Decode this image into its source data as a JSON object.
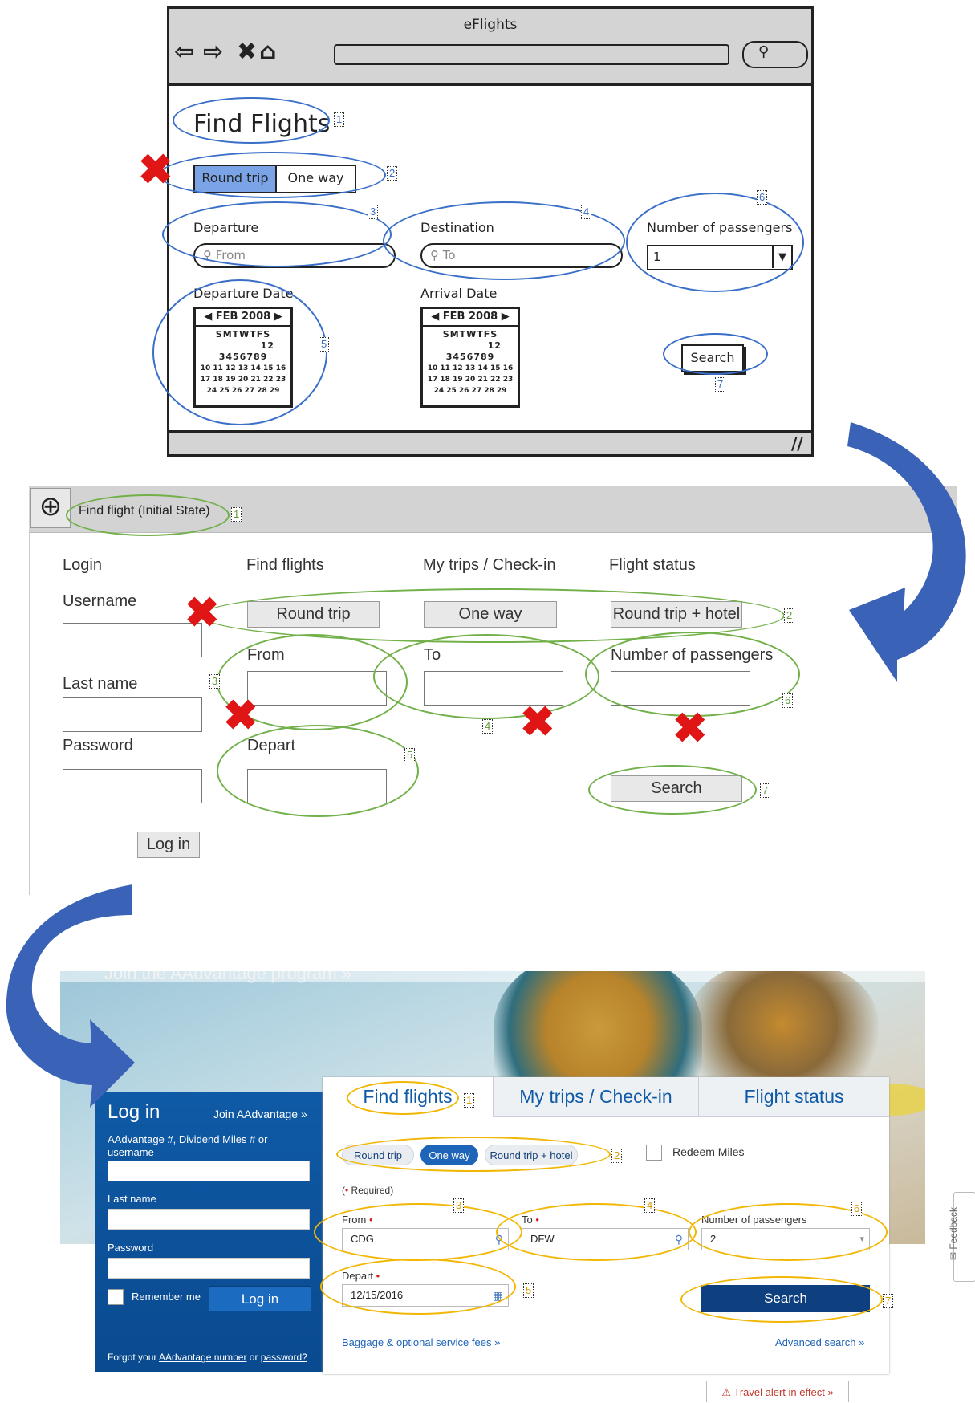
{
  "mockup": {
    "window_title": "eFlights",
    "heading": "Find Flights",
    "trip_options": [
      "Round trip",
      "One way"
    ],
    "departure_label": "Departure",
    "departure_placeholder": "From",
    "destination_label": "Destination",
    "destination_placeholder": "To",
    "passengers_label": "Number of passengers",
    "passengers_value": "1",
    "departure_date_label": "Departure Date",
    "arrival_date_label": "Arrival Date",
    "calendar": {
      "month": "FEB 2008",
      "weekdays": "SMTWTFS",
      "row1": "12",
      "row2": "3456789",
      "row3": "10 11 12 13 14 15 16",
      "row4": "17 18 19 20 21 22 23",
      "row5": "24 25 26 27 28 29"
    },
    "search_label": "Search",
    "annotations": [
      "1",
      "2",
      "3",
      "4",
      "5",
      "6",
      "7"
    ]
  },
  "wireframe": {
    "title": "Find flight   (Initial State)",
    "nav": [
      "Login",
      "Find flights",
      "My trips / Check-in",
      "Flight status"
    ],
    "username_label": "Username",
    "lastname_label": "Last name",
    "password_label": "Password",
    "login_button": "Log in",
    "trip_buttons": [
      "Round trip",
      "One way",
      "Round trip + hotel"
    ],
    "from_label": "From",
    "to_label": "To",
    "passengers_label": "Number of passengers",
    "depart_label": "Depart",
    "search_button": "Search",
    "annotations": [
      "1",
      "2",
      "3",
      "4",
      "5",
      "6",
      "7"
    ]
  },
  "site": {
    "hero_text": "Join the AAdvantage program »",
    "login": {
      "title": "Log in",
      "join_link": "Join AAdvantage »",
      "username_label": "AAdvantage #, Dividend Miles # or username",
      "lastname_label": "Last name",
      "password_label": "Password",
      "remember_label": "Remember me",
      "login_button": "Log in",
      "forgot_prefix": "Forgot your ",
      "forgot_number": "AAdvantage number",
      "forgot_or": " or ",
      "forgot_password": "password?"
    },
    "tabs": [
      "Find flights",
      "My trips / Check-in",
      "Flight status"
    ],
    "trip_pills": [
      "Round trip",
      "One way",
      "Round trip + hotel"
    ],
    "redeem_label": "Redeem Miles",
    "required_note_open": "(",
    "required_note_star": "•",
    "required_note_text": " Required)",
    "from_label": "From",
    "from_value": "CDG",
    "to_label": "To",
    "to_value": "DFW",
    "passengers_label": "Number of passengers",
    "passengers_value": "2",
    "depart_label": "Depart",
    "depart_value": "12/15/2016",
    "search_button": "Search",
    "baggage_link": "Baggage & optional service fees  »",
    "advanced_link": "Advanced search »",
    "travel_alert": "⚠  Travel alert in effect »",
    "feedback": "✉ Feedback",
    "required_star": "•",
    "annotations": [
      "1",
      "2",
      "3",
      "4",
      "5",
      "6",
      "7"
    ]
  },
  "colors": {
    "sketch_ellipse": "#3a6fc8",
    "wireframe_ellipse": "#72b04a",
    "site_ellipse": "#f2b705",
    "x_mark": "#e01515",
    "arrow": "#3a63b8",
    "aa_blue": "#0f5aa6"
  }
}
